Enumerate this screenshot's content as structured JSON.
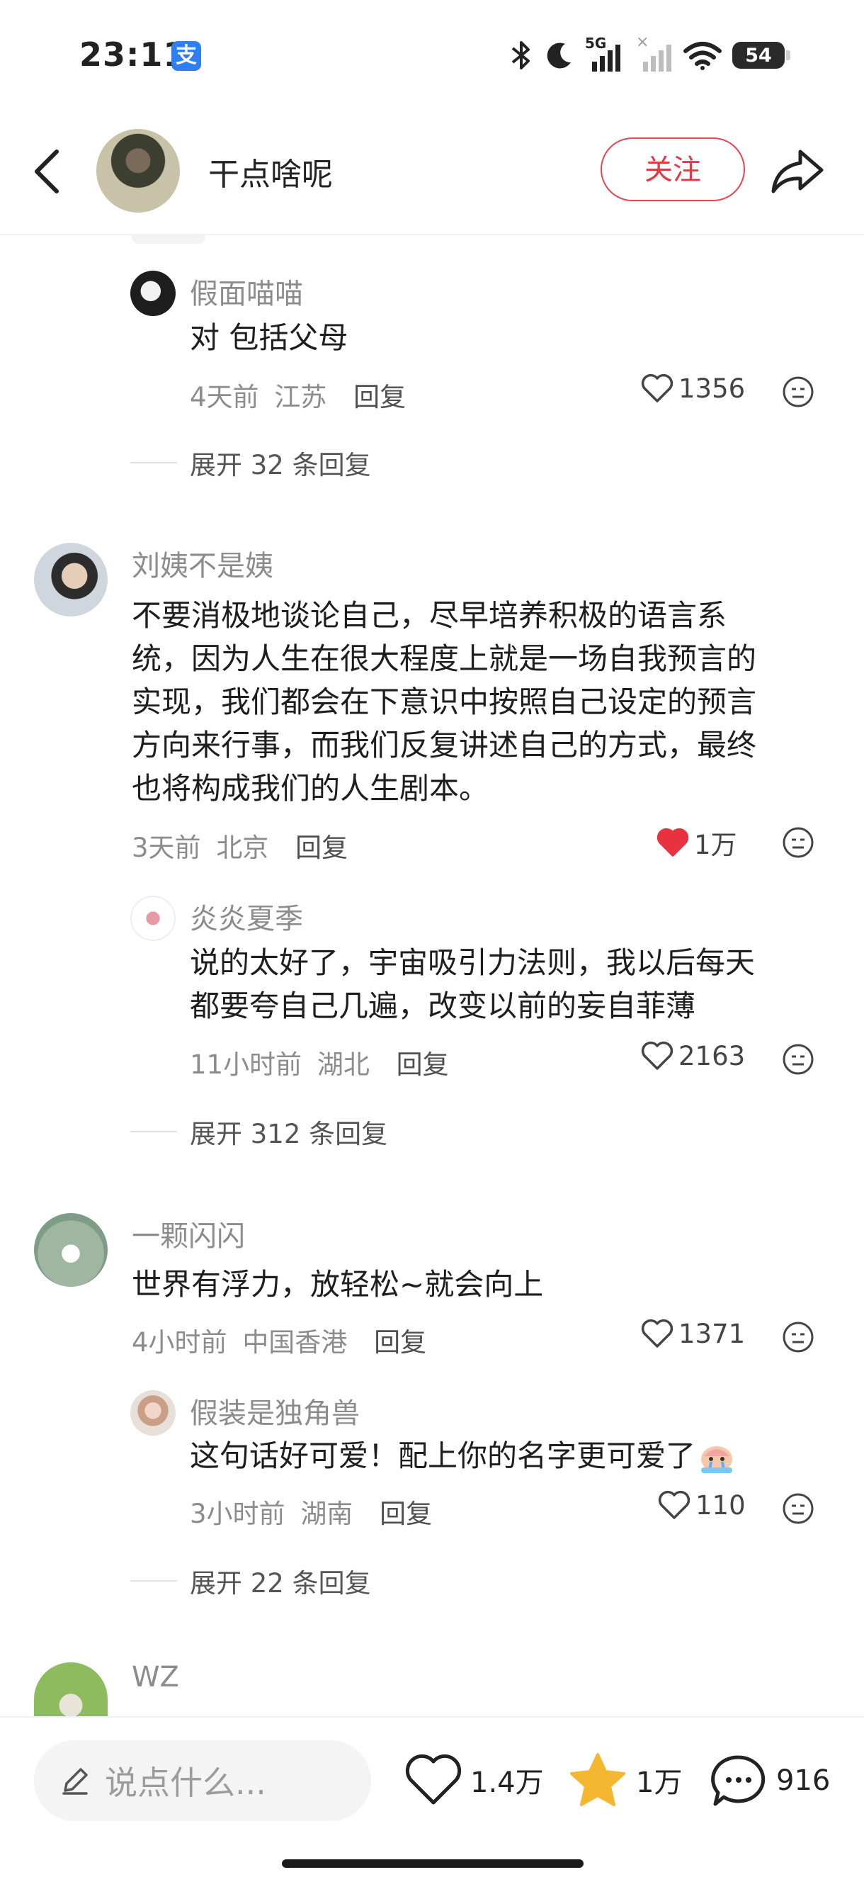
{
  "status_bar": {
    "time": "23:11",
    "app_badge": "支",
    "network": "5G",
    "battery": "54"
  },
  "header": {
    "author_name": "干点啥呢",
    "follow_label": "关注"
  },
  "comments": [
    {
      "reply": {
        "username": "假面喵喵",
        "text": "对 包括父母",
        "time": "4天前",
        "location": "江苏",
        "reply_label": "回复",
        "likes": "1356"
      },
      "expand_label": "展开 32 条回复"
    },
    {
      "username": "刘姨不是姨",
      "text_lines": [
        "不要消极地谈论自己，尽早培养积极的语言系",
        "统，因为人生在很大程度上就是一场自我预言的",
        "实现，我们都会在下意识中按照自己设定的预言",
        "方向来行事，而我们反复讲述自己的方式，最终",
        "也将构成我们的人生剧本。"
      ],
      "time": "3天前",
      "location": "北京",
      "reply_label": "回复",
      "likes": "1万",
      "liked": true,
      "reply": {
        "username": "炎炎夏季",
        "text_lines": [
          "说的太好了，宇宙吸引力法则，我以后每天",
          "都要夸自己几遍，改变以前的妄自菲薄"
        ],
        "time": "11小时前",
        "location": "湖北",
        "reply_label": "回复",
        "likes": "2163"
      },
      "expand_label": "展开 312 条回复"
    },
    {
      "username": "一颗闪闪",
      "text": "世界有浮力，放轻松~就会向上",
      "time": "4小时前",
      "location": "中国香港",
      "reply_label": "回复",
      "likes": "1371",
      "reply": {
        "username": "假装是独角兽",
        "text": "这句话好可爱！配上你的名字更可爱了",
        "time": "3小时前",
        "location": "湖南",
        "reply_label": "回复",
        "likes": "110"
      },
      "expand_label": "展开 22 条回复"
    },
    {
      "username": "WZ"
    }
  ],
  "bottom_bar": {
    "placeholder": "说点什么...",
    "likes": "1.4万",
    "favorites": "1万",
    "comments": "916"
  },
  "colors": {
    "accent_red": "#e23a48",
    "liked_heart": "#e8323f",
    "star_yellow": "#f5b731",
    "muted_text": "#8c8c8c"
  },
  "icons": [
    "back-arrow-icon",
    "share-icon",
    "heart-icon",
    "emoji-icon",
    "pen-icon",
    "star-icon",
    "comment-bubble-icon"
  ]
}
